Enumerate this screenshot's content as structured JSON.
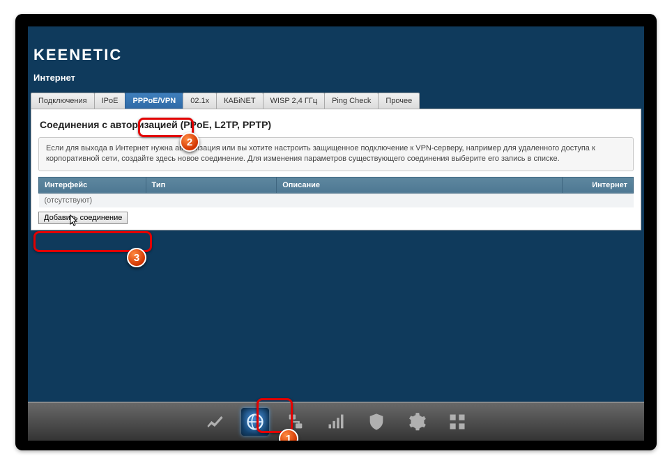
{
  "brand": "KEENETIC",
  "page_title": "Интернет",
  "tabs": [
    {
      "label": "Подключения"
    },
    {
      "label": "IPoE"
    },
    {
      "label": "PPPoE/VPN",
      "active": true
    },
    {
      "label": "02.1x"
    },
    {
      "label": "КАБiNET"
    },
    {
      "label": "WISP 2,4 ГГц"
    },
    {
      "label": "Ping Check"
    },
    {
      "label": "Прочее"
    }
  ],
  "panel": {
    "title": "Соединения с авторизацией (PPoE, L2TP, PPTP)",
    "description": "Если для выхода в Интернет нужна авторизация или вы хотите настроить защищенное подключение к VPN-серверу, например для удаленного доступа к корпоративной сети, создайте здесь новое соединение. Для изменения параметров существующего соединения выберите его запись в списке.",
    "columns": {
      "interface": "Интерфейс",
      "type": "Тип",
      "description": "Описание",
      "internet": "Интернет"
    },
    "empty_row": "(отсутствуют)",
    "add_button": "Добавить соединение"
  },
  "callouts": {
    "b1": "1",
    "b2": "2",
    "b3": "3"
  }
}
